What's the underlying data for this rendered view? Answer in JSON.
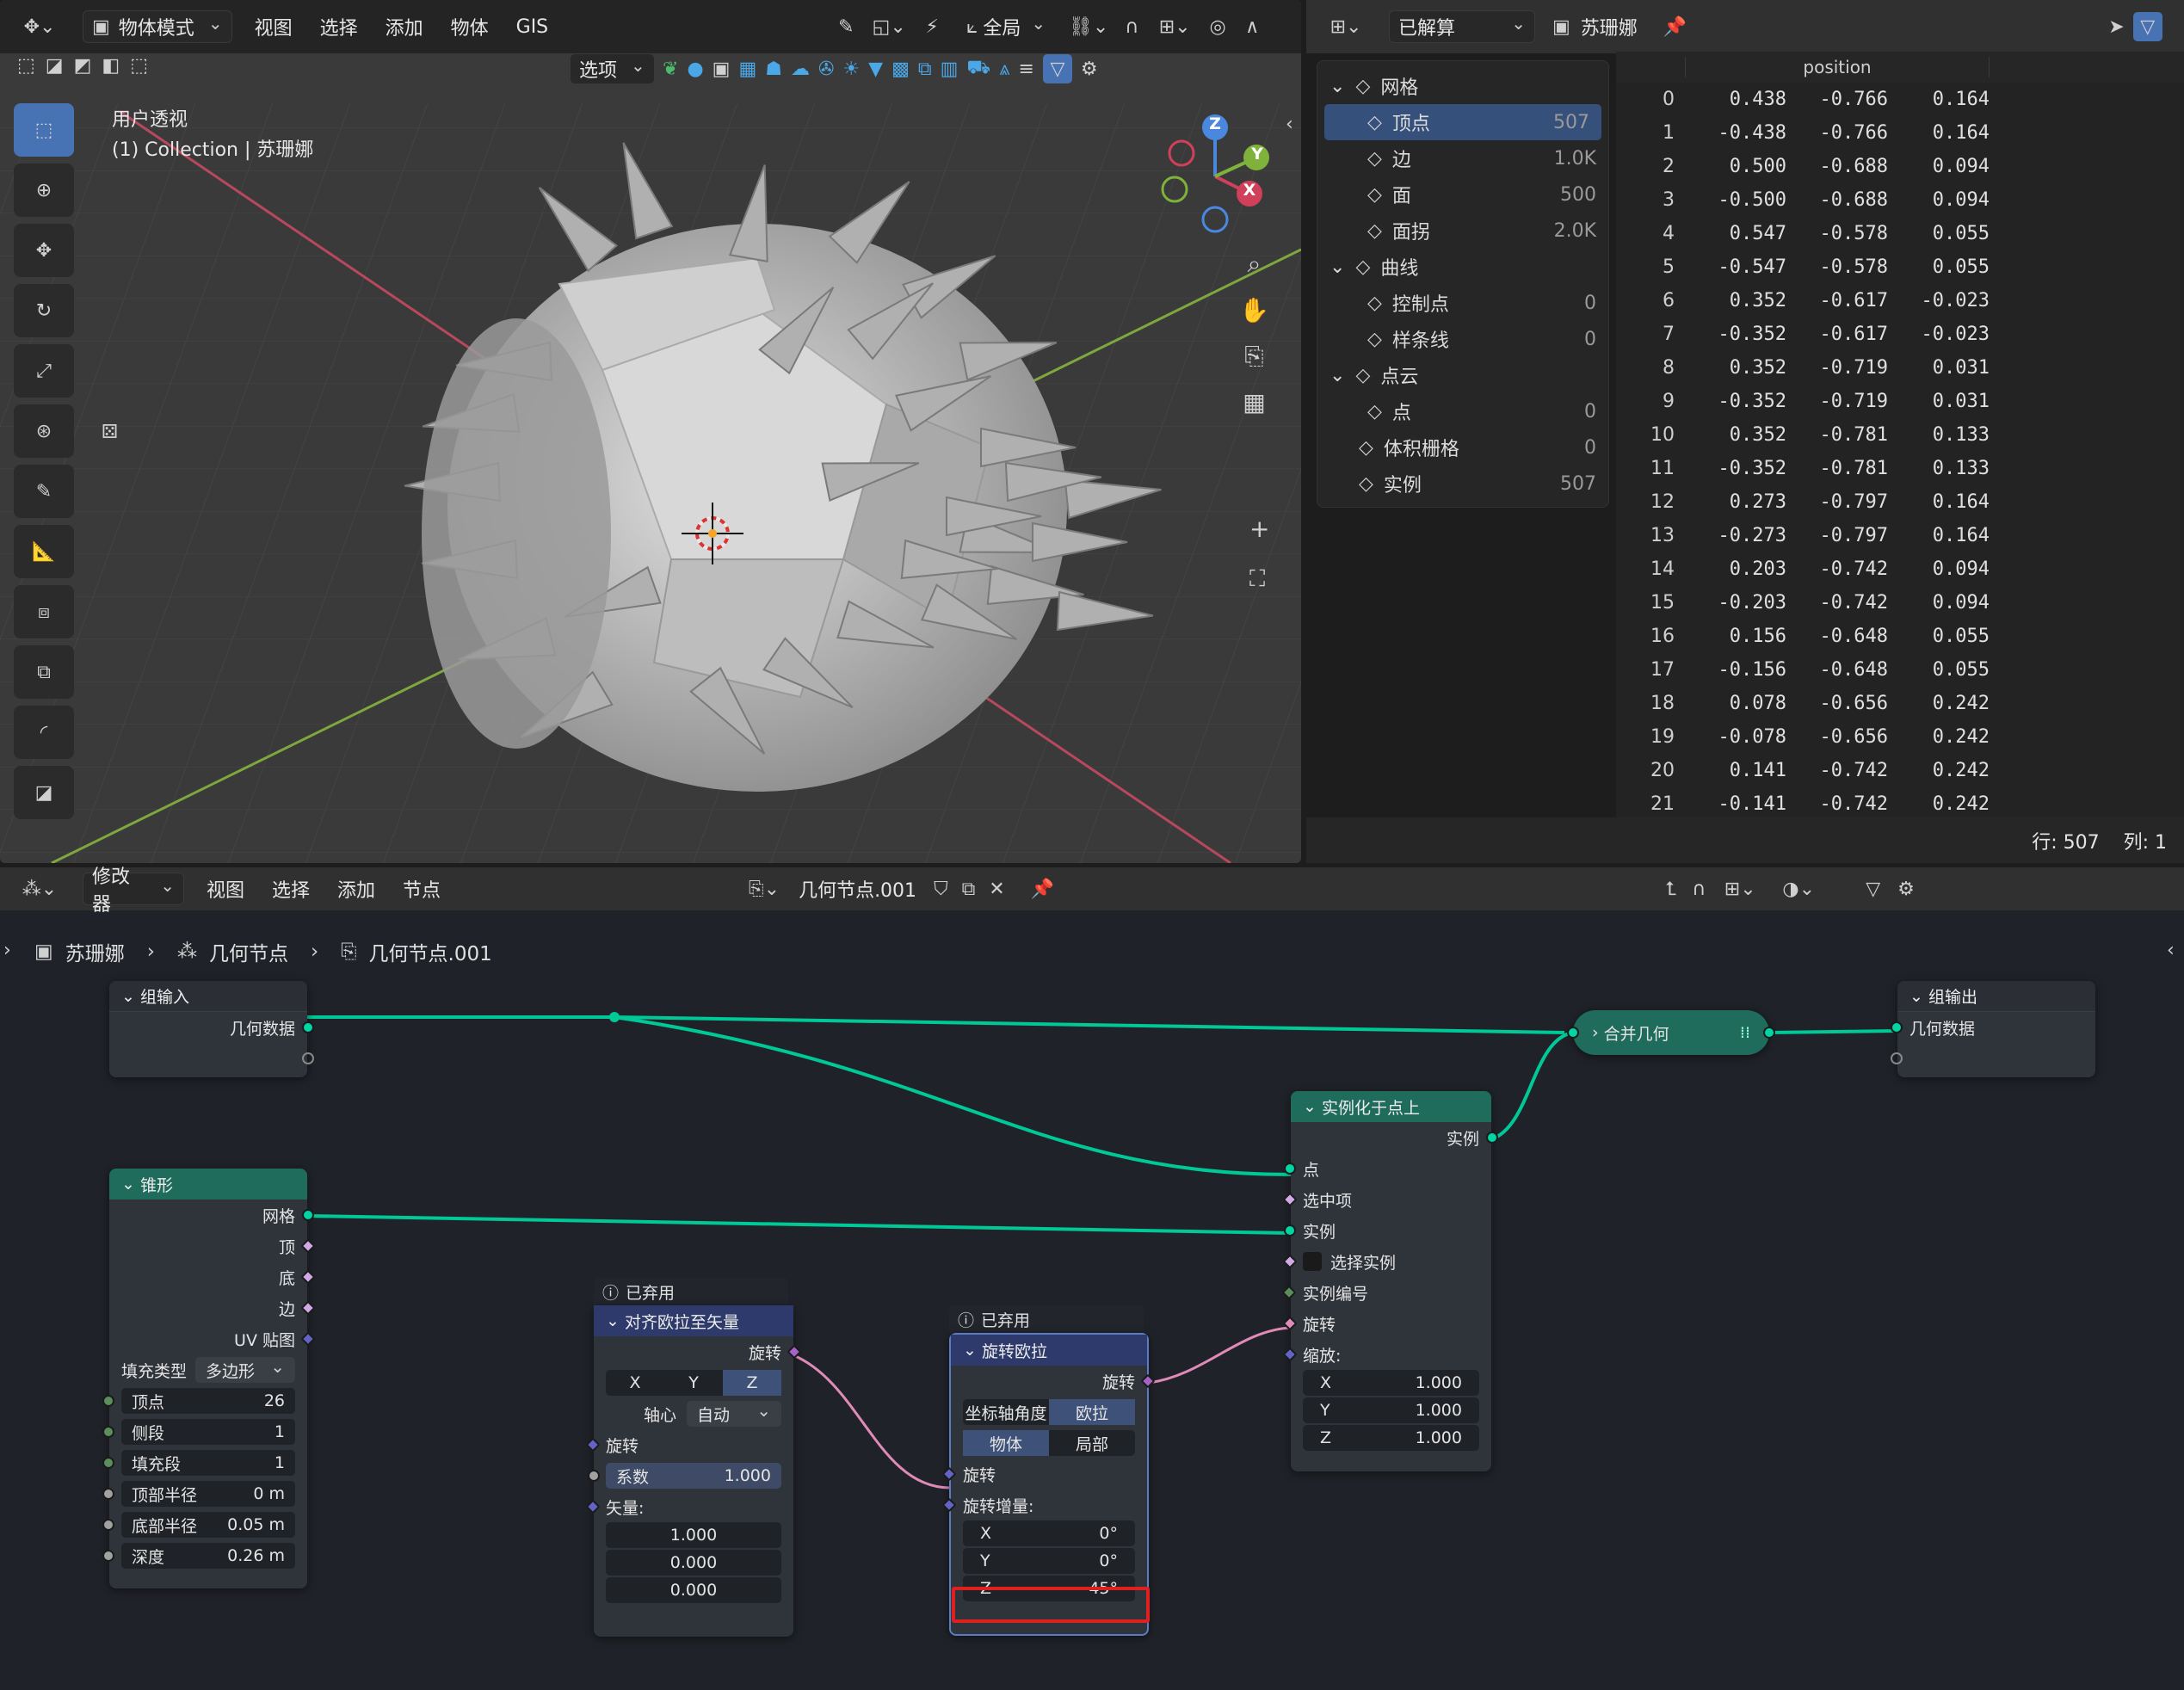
{
  "viewport": {
    "mode": "物体模式",
    "menus": [
      "视图",
      "选择",
      "添加",
      "物体",
      "GIS"
    ],
    "transform_orientation": "全局",
    "options_label": "选项",
    "view_name": "用户透视",
    "collection_info": "(1) Collection | 苏珊娜",
    "axis_labels": {
      "x": "X",
      "y": "Y",
      "z": "Z"
    },
    "tools": [
      "select-box",
      "cursor",
      "move",
      "rotate",
      "scale",
      "transform",
      "annotate",
      "measure",
      "add-cube",
      "scale-cage",
      "tool-a",
      "tool-b"
    ],
    "colors": {
      "bg": "#3a3a3a",
      "x_axis": "#c3405a",
      "y_axis": "#7fa73f",
      "mesh": "#b8b8b8"
    }
  },
  "spreadsheet": {
    "mode": "已解算",
    "object": "苏珊娜",
    "tree": [
      {
        "label": "网格",
        "count": "",
        "level": 0,
        "icon": "mesh-icon"
      },
      {
        "label": "顶点",
        "count": "507",
        "level": 1,
        "selected": true,
        "icon": "vertex-icon"
      },
      {
        "label": "边",
        "count": "1.0K",
        "level": 1,
        "icon": "edge-icon"
      },
      {
        "label": "面",
        "count": "500",
        "level": 1,
        "icon": "face-icon"
      },
      {
        "label": "面拐",
        "count": "2.0K",
        "level": 1,
        "icon": "face-corner-icon"
      },
      {
        "label": "曲线",
        "count": "",
        "level": 0,
        "icon": "curve-icon"
      },
      {
        "label": "控制点",
        "count": "0",
        "level": 1,
        "icon": "control-point-icon"
      },
      {
        "label": "样条线",
        "count": "0",
        "level": 1,
        "icon": "spline-icon"
      },
      {
        "label": "点云",
        "count": "",
        "level": 0,
        "icon": "point-cloud-icon"
      },
      {
        "label": "点",
        "count": "0",
        "level": 1,
        "icon": "point-icon"
      },
      {
        "label": "体积栅格",
        "count": "0",
        "level": 0,
        "icon": "volume-icon"
      },
      {
        "label": "实例",
        "count": "507",
        "level": 0,
        "icon": "instance-icon"
      }
    ],
    "column_header": "position",
    "rows": [
      [
        "0",
        "0.438",
        "-0.766",
        "0.164"
      ],
      [
        "1",
        "-0.438",
        "-0.766",
        "0.164"
      ],
      [
        "2",
        "0.500",
        "-0.688",
        "0.094"
      ],
      [
        "3",
        "-0.500",
        "-0.688",
        "0.094"
      ],
      [
        "4",
        "0.547",
        "-0.578",
        "0.055"
      ],
      [
        "5",
        "-0.547",
        "-0.578",
        "0.055"
      ],
      [
        "6",
        "0.352",
        "-0.617",
        "-0.023"
      ],
      [
        "7",
        "-0.352",
        "-0.617",
        "-0.023"
      ],
      [
        "8",
        "0.352",
        "-0.719",
        "0.031"
      ],
      [
        "9",
        "-0.352",
        "-0.719",
        "0.031"
      ],
      [
        "10",
        "0.352",
        "-0.781",
        "0.133"
      ],
      [
        "11",
        "-0.352",
        "-0.781",
        "0.133"
      ],
      [
        "12",
        "0.273",
        "-0.797",
        "0.164"
      ],
      [
        "13",
        "-0.273",
        "-0.797",
        "0.164"
      ],
      [
        "14",
        "0.203",
        "-0.742",
        "0.094"
      ],
      [
        "15",
        "-0.203",
        "-0.742",
        "0.094"
      ],
      [
        "16",
        "0.156",
        "-0.648",
        "0.055"
      ],
      [
        "17",
        "-0.156",
        "-0.648",
        "0.055"
      ],
      [
        "18",
        "0.078",
        "-0.656",
        "0.242"
      ],
      [
        "19",
        "-0.078",
        "-0.656",
        "0.242"
      ],
      [
        "20",
        "0.141",
        "-0.742",
        "0.242"
      ],
      [
        "21",
        "-0.141",
        "-0.742",
        "0.242"
      ]
    ],
    "footer_rows": "行: 507",
    "footer_cols": "列: 1"
  },
  "node_editor": {
    "mode": "修改器",
    "menus": [
      "视图",
      "选择",
      "添加",
      "节点"
    ],
    "tree_name": "几何节点.001",
    "breadcrumb": [
      "苏珊娜",
      "几何节点",
      "几何节点.001"
    ],
    "group_input": {
      "title": "组输入",
      "geometry": "几何数据"
    },
    "cone": {
      "title": "锥形",
      "outputs": [
        "网格",
        "顶",
        "底",
        "边",
        "UV 贴图"
      ],
      "fill_type_label": "填充类型",
      "fill_type_value": "多边形",
      "fields": [
        {
          "label": "顶点",
          "value": "26"
        },
        {
          "label": "侧段",
          "value": "1"
        },
        {
          "label": "填充段",
          "value": "1"
        },
        {
          "label": "顶部半径",
          "value": "0 m"
        },
        {
          "label": "底部半径",
          "value": "0.05 m"
        },
        {
          "label": "深度",
          "value": "0.26 m"
        }
      ]
    },
    "align": {
      "disabled_label": "已弃用",
      "title": "对齐欧拉至矢量",
      "output": "旋转",
      "axes": [
        "X",
        "Y",
        "Z"
      ],
      "active_axis": "Z",
      "pivot_label": "轴心",
      "pivot_value": "自动",
      "rotation_label": "旋转",
      "factor_label": "系数",
      "factor_value": "1.000",
      "vector_label": "矢量:",
      "vector": [
        "1.000",
        "0.000",
        "0.000"
      ]
    },
    "rotate": {
      "disabled_label": "已弃用",
      "title": "旋转欧拉",
      "output": "旋转",
      "axis_angle_label": "坐标轴角度",
      "euler_label": "欧拉",
      "space_object": "物体",
      "space_local": "局部",
      "rotation_label": "旋转",
      "delta_label": "旋转增量:",
      "delta": [
        {
          "axis": "X",
          "value": "0°"
        },
        {
          "axis": "Y",
          "value": "0°"
        },
        {
          "axis": "Z",
          "value": "45°"
        }
      ]
    },
    "instance": {
      "title": "实例化于点上",
      "output": "实例",
      "inputs": [
        "点",
        "选中项",
        "实例",
        "选择实例",
        "实例编号",
        "旋转"
      ],
      "scale_label": "缩放:",
      "scale": [
        {
          "axis": "X",
          "value": "1.000"
        },
        {
          "axis": "Y",
          "value": "1.000"
        },
        {
          "axis": "Z",
          "value": "1.000"
        }
      ]
    },
    "join": {
      "title": "合并几何"
    },
    "group_output": {
      "title": "组输出",
      "geometry": "几何数据"
    },
    "colors": {
      "geometry": "#00d6a3",
      "rotation": "#e08ab8",
      "highlight": "#e02020"
    }
  }
}
